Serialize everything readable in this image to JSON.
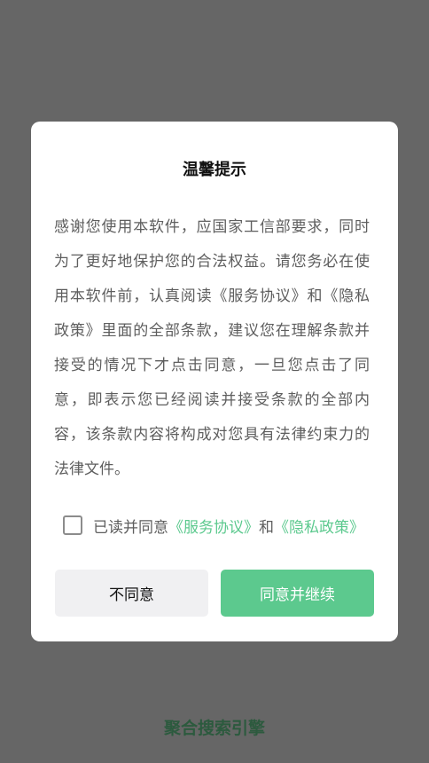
{
  "dialog": {
    "title": "温馨提示",
    "body": "感谢您使用本软件，应国家工信部要求，同时为了更好地保护您的合法权益。请您务必在使用本软件前，认真阅读《服务协议》和《隐私政策》里面的全部条款，建议您在理解条款并接受的情况下才点击同意，一旦您点击了同意，即表示您已经阅读并接受条款的全部内容，该条款内容将构成对您具有法律约束力的法律文件。",
    "agreement": {
      "checked": false,
      "prefix": "已读并同意",
      "service_link": "《服务协议》",
      "conjunction": "和",
      "privacy_link": "《隐私政策》"
    },
    "buttons": {
      "disagree": "不同意",
      "agree": "同意并继续"
    }
  },
  "background": {
    "brand_text": "聚合搜索引擎"
  },
  "colors": {
    "overlay": "#666666",
    "accent": "#5cc98e",
    "brand": "#2c5a3e"
  }
}
